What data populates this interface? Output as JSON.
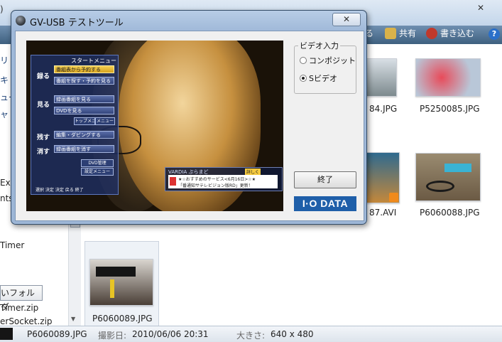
{
  "explorer": {
    "top_fragment": ")",
    "toolbar": {
      "partial_label": "る",
      "share": "共有",
      "write": "書き込む",
      "help_icon": "help-icon"
    },
    "nav": {
      "fragments": [
        "リ",
        "キ",
        "ュー",
        "ャ",
        "Exp",
        "nts",
        "Timer",
        "Timer.zip",
        "erSocket.zip"
      ],
      "folder_button": "いフォルダ"
    },
    "files": [
      {
        "name": "84.JPG"
      },
      {
        "name": "P5250085.JPG"
      },
      {
        "name": "87.AVI"
      },
      {
        "name": "P6060088.JPG"
      },
      {
        "name": "P6060089.JPG"
      }
    ],
    "status": {
      "filename": "P6060089.JPG",
      "date_label": "撮影日:",
      "date_value": "2010/06/06 20:31",
      "size_label": "大きさ:",
      "size_value": "640 x 480"
    }
  },
  "dialog": {
    "title": "GV-USB テストツール",
    "close_label": "✕",
    "video_input": {
      "legend": "ビデオ入力",
      "options": [
        {
          "label": "コンポジット",
          "selected": false
        },
        {
          "label": "Sビデオ",
          "selected": true
        }
      ]
    },
    "exit_button": "終了",
    "logo": "I·O DATA",
    "preview": {
      "menu_title": "スタートメニュー",
      "side_labels": [
        "録る",
        "見る",
        "残す",
        "消す"
      ],
      "buttons": [
        "番組表から予約する",
        "番組を探す・予約を見る",
        "録画番組を見る",
        "DVDを見る",
        "編集・ダビングする",
        "録画番組を消す"
      ],
      "small_buttons": [
        "トップメニュー",
        "メニュー",
        "DVD管理",
        "設定メニュー"
      ],
      "footer": "選択 決定 決定 戻る 終了",
      "ticker_brand": "VARDIA ぷらまど",
      "ticker_badge": "詳しく",
      "ticker_line1": "★☆おすすめのサービス<6月16日>☆★",
      "ticker_line2": "「番通知サテレビジョン版RD」更新！"
    }
  }
}
